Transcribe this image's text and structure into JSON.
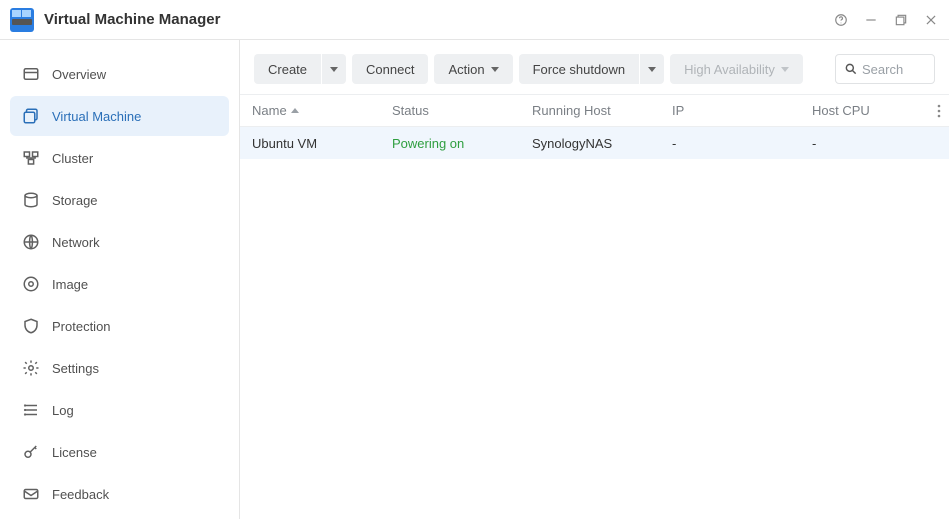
{
  "titlebar": {
    "title": "Virtual Machine Manager"
  },
  "sidebar": {
    "items": [
      {
        "label": "Overview"
      },
      {
        "label": "Virtual Machine"
      },
      {
        "label": "Cluster"
      },
      {
        "label": "Storage"
      },
      {
        "label": "Network"
      },
      {
        "label": "Image"
      },
      {
        "label": "Protection"
      },
      {
        "label": "Settings"
      },
      {
        "label": "Log"
      },
      {
        "label": "License"
      },
      {
        "label": "Feedback"
      }
    ],
    "active_index": 1
  },
  "toolbar": {
    "create": "Create",
    "connect": "Connect",
    "action": "Action",
    "force_shutdown": "Force shutdown",
    "high_availability": "High Availability",
    "search_placeholder": "Search"
  },
  "table": {
    "columns": {
      "name": "Name",
      "status": "Status",
      "host": "Running Host",
      "ip": "IP",
      "cpu": "Host CPU"
    },
    "rows": [
      {
        "name": "Ubuntu VM",
        "status": "Powering on",
        "status_class": "status-powering",
        "host": "SynologyNAS",
        "ip": "-",
        "cpu": "-"
      }
    ]
  }
}
